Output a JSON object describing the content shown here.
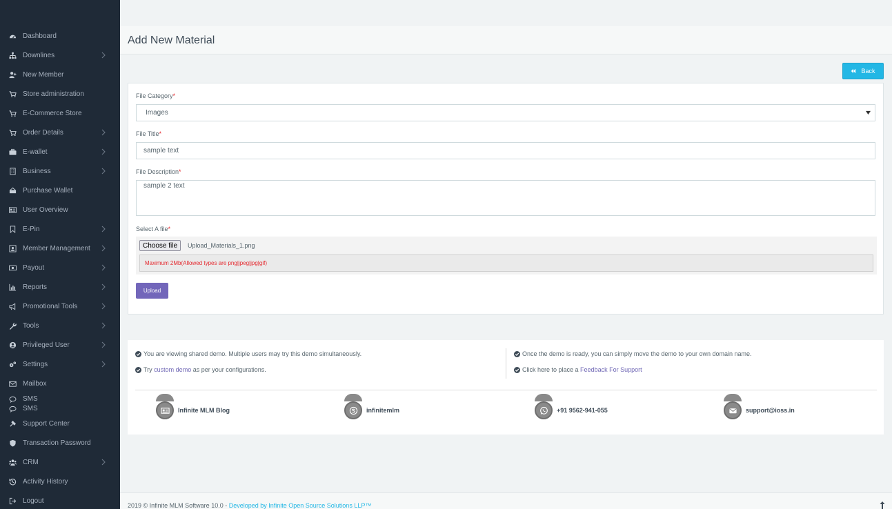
{
  "sidebar": {
    "items": [
      {
        "label": "Dashboard",
        "icon": "dashboard-icon",
        "chevron": false
      },
      {
        "label": "Downlines",
        "icon": "sitemap-icon",
        "chevron": true
      },
      {
        "label": "New Member",
        "icon": "user-plus-icon",
        "chevron": false
      },
      {
        "label": "Store administration",
        "icon": "cart-icon",
        "chevron": false
      },
      {
        "label": "E-Commerce Store",
        "icon": "cart-icon",
        "chevron": false
      },
      {
        "label": "Order Details",
        "icon": "cart-icon",
        "chevron": true
      },
      {
        "label": "E-wallet",
        "icon": "briefcase-icon",
        "chevron": true
      },
      {
        "label": "Business",
        "icon": "building-icon",
        "chevron": true
      },
      {
        "label": "Purchase Wallet",
        "icon": "wallet-icon",
        "chevron": false
      },
      {
        "label": "User Overview",
        "icon": "id-card-icon",
        "chevron": false
      },
      {
        "label": "E-Pin",
        "icon": "bookmark-icon",
        "chevron": true
      },
      {
        "label": "Member Management",
        "icon": "user-box-icon",
        "chevron": true
      },
      {
        "label": "Payout",
        "icon": "money-icon",
        "chevron": true
      },
      {
        "label": "Reports",
        "icon": "bar-chart-icon",
        "chevron": true
      },
      {
        "label": "Promotional Tools",
        "icon": "bullhorn-icon",
        "chevron": true
      },
      {
        "label": "Tools",
        "icon": "wrench-icon",
        "chevron": true
      },
      {
        "label": "Privileged User",
        "icon": "user-circle-icon",
        "chevron": true
      },
      {
        "label": "Settings",
        "icon": "gears-icon",
        "chevron": true
      },
      {
        "label": "Mailbox",
        "icon": "envelope-icon",
        "chevron": false
      }
    ],
    "sms": {
      "label1": "SMS",
      "label2": "SMS",
      "icon": "chat-icon"
    },
    "items2": [
      {
        "label": "Support Center",
        "icon": "tools-icon",
        "chevron": false
      },
      {
        "label": "Transaction Password",
        "icon": "shield-icon",
        "chevron": false
      },
      {
        "label": "CRM",
        "icon": "users-icon",
        "chevron": true
      },
      {
        "label": "Activity History",
        "icon": "history-icon",
        "chevron": false
      },
      {
        "label": "Logout",
        "icon": "logout-icon",
        "chevron": false
      }
    ]
  },
  "header": {
    "title": "Add New Material"
  },
  "back_button": {
    "label": "Back"
  },
  "form": {
    "category_label": "File Category",
    "category_value": "Images",
    "title_label": "File Title",
    "title_value": "sample text",
    "description_label": "File Description",
    "description_value": "sample 2 text",
    "file_label": "Select A file",
    "required_mark": "*",
    "choose_button": "Choose file",
    "file_name": "Upload_Materials_1.png",
    "file_hint": "Maximum 2Mb(Allowed types are png|jpeg|jpg|gif)",
    "upload_button": "Upload"
  },
  "info": {
    "line1": "You are viewing shared demo. Multiple users may try this demo simultaneously.",
    "line2_pre": "Try ",
    "line2_link": "custom demo",
    "line2_post": " as per your configurations.",
    "line3": "Once the demo is ready, you can simply move the demo to your own domain name.",
    "line4_pre": "Click here to place a ",
    "line4_link": "Feedback For Support"
  },
  "contacts": [
    {
      "label": "Infinite MLM Blog",
      "icon": "newspaper-icon"
    },
    {
      "label": "infinitemlm",
      "icon": "skype-icon"
    },
    {
      "label": "+91 9562-941-055",
      "icon": "whatsapp-icon"
    },
    {
      "label": "support@ioss.in",
      "icon": "envelope-icon"
    }
  ],
  "footer": {
    "text": "2019 © Infinite MLM Software 10.0 - ",
    "link": "Developed by Infinite Open Source Solutions LLP™"
  },
  "colors": {
    "sidebar_bg": "#1f2a37",
    "accent_blue": "#23b7e5",
    "accent_purple": "#7266ba",
    "required_red": "#e5272d"
  }
}
